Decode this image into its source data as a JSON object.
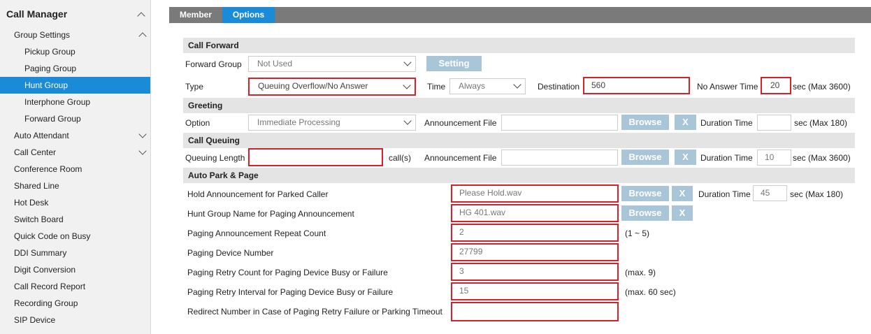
{
  "sidebar": {
    "title": "Call Manager",
    "items": [
      {
        "label": "Group Settings"
      },
      {
        "label": "Pickup Group"
      },
      {
        "label": "Paging Group"
      },
      {
        "label": "Hunt Group"
      },
      {
        "label": "Interphone Group"
      },
      {
        "label": "Forward Group"
      },
      {
        "label": "Auto Attendant"
      },
      {
        "label": "Call Center"
      },
      {
        "label": "Conference Room"
      },
      {
        "label": "Shared Line"
      },
      {
        "label": "Hot Desk"
      },
      {
        "label": "Switch Board"
      },
      {
        "label": "Quick Code on Busy"
      },
      {
        "label": "DDI Summary"
      },
      {
        "label": "Digit Conversion"
      },
      {
        "label": "Call Record Report"
      },
      {
        "label": "Recording Group"
      },
      {
        "label": "SIP Device"
      }
    ]
  },
  "tabs": [
    {
      "label": "Member"
    },
    {
      "label": "Options"
    }
  ],
  "colors": {
    "accent": "#1a8bd6",
    "highlight": "#d8202a",
    "button": "#a9c6d8"
  },
  "call_forward": {
    "title": "Call Forward",
    "forward_group_label": "Forward Group",
    "forward_group_value": "Not Used",
    "setting_button": "Setting",
    "type_label": "Type",
    "type_value": "Queuing Overflow/No Answer",
    "time_label": "Time",
    "time_value": "Always",
    "destination_label": "Destination",
    "destination_value": "560",
    "no_answer_label": "No Answer Time",
    "no_answer_value": "20",
    "no_answer_unit": "sec (Max 3600)"
  },
  "greeting": {
    "title": "Greeting",
    "option_label": "Option",
    "option_value": "Immediate Processing",
    "announcement_label": "Announcement File",
    "announcement_value": "",
    "browse": "Browse",
    "clear": "X",
    "duration_label": "Duration Time",
    "duration_value": "",
    "duration_unit": "sec (Max 180)"
  },
  "call_queuing": {
    "title": "Call Queuing",
    "length_label": "Queuing Length",
    "length_value": "",
    "length_unit": "call(s)",
    "announcement_label": "Announcement File",
    "announcement_value": "",
    "browse": "Browse",
    "clear": "X",
    "duration_label": "Duration Time",
    "duration_value": "10",
    "duration_unit": "sec (Max 3600)"
  },
  "auto_park": {
    "title": "Auto Park & Page",
    "hold_label": "Hold Announcement for Parked Caller",
    "hold_value": "Please Hold.wav",
    "hold_browse": "Browse",
    "hold_clear": "X",
    "hold_duration_label": "Duration Time",
    "hold_duration_value": "45",
    "hold_duration_unit": "sec (Max 180)",
    "name_label": "Hunt Group Name for Paging Announcement",
    "name_value": "HG 401.wav",
    "name_browse": "Browse",
    "name_clear": "X",
    "repeat_label": "Paging Announcement Repeat Count",
    "repeat_value": "2",
    "repeat_hint": "(1 ~ 5)",
    "device_label": "Paging Device Number",
    "device_value": "27799",
    "retry_count_label": "Paging Retry Count for Paging Device Busy or Failure",
    "retry_count_value": "3",
    "retry_count_hint": "(max. 9)",
    "retry_interval_label": "Paging Retry Interval for Paging Device Busy or Failure",
    "retry_interval_value": "15",
    "retry_interval_hint": "(max. 60 sec)",
    "redirect_label": "Redirect Number in Case of Paging Retry Failure or Parking Timeout",
    "redirect_value": ""
  }
}
